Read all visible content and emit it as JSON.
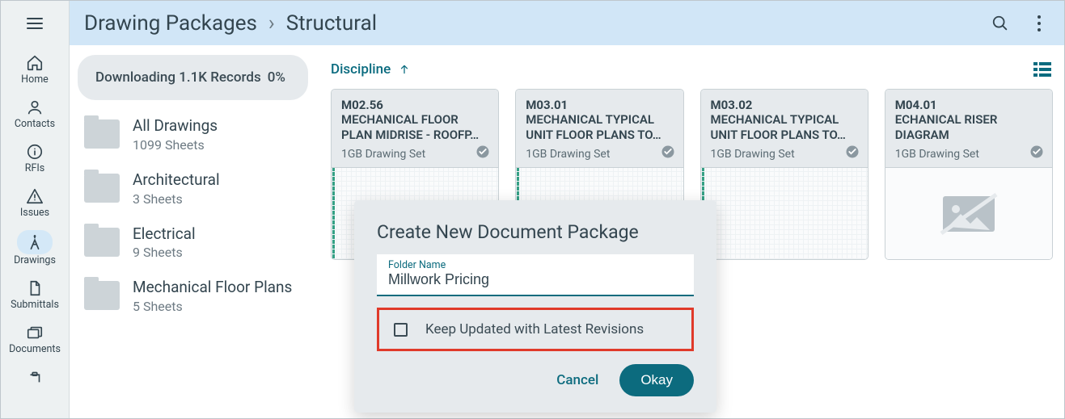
{
  "header": {
    "breadcrumb_root": "Drawing Packages",
    "breadcrumb_current": "Structural"
  },
  "sidebar": {
    "items": [
      {
        "label": "Home"
      },
      {
        "label": "Contacts"
      },
      {
        "label": "RFIs"
      },
      {
        "label": "Issues"
      },
      {
        "label": "Drawings"
      },
      {
        "label": "Submittals"
      },
      {
        "label": "Documents"
      }
    ]
  },
  "leftpanel": {
    "download_status_prefix": "Downloading 1.1K Records",
    "download_percent": "0%"
  },
  "folders": [
    {
      "name": "All Drawings",
      "sub": "1099 Sheets"
    },
    {
      "name": "Architectural",
      "sub": "3 Sheets"
    },
    {
      "name": "Electrical",
      "sub": "9 Sheets"
    },
    {
      "name": "Mechanical Floor Plans",
      "sub": "5 Sheets"
    }
  ],
  "sort": {
    "label": "Discipline"
  },
  "cards": [
    {
      "code": "M02.56",
      "title": "MECHANICAL FLOOR PLAN MIDRISE - ROOFP…",
      "set": "1GB Drawing Set"
    },
    {
      "code": "M03.01",
      "title": "MECHANICAL TYPICAL UNIT FLOOR PLANS TO…",
      "set": "1GB Drawing Set"
    },
    {
      "code": "M03.02",
      "title": "MECHANICAL TYPICAL UNIT FLOOR PLANS TO…",
      "set": "1GB Drawing Set"
    },
    {
      "code": "M04.01",
      "title": "ECHANICAL RISER DIAGRAM",
      "set": "1GB Drawing Set"
    }
  ],
  "dialog": {
    "title": "Create New Document Package",
    "field_label": "Folder Name",
    "field_value": "Millwork Pricing",
    "checkbox_label": "Keep Updated with Latest Revisions",
    "cancel": "Cancel",
    "okay": "Okay"
  },
  "colors": {
    "accent": "#0c6b7e",
    "highlight_border": "#e03a2a",
    "header_bg": "#d1e6f7"
  }
}
